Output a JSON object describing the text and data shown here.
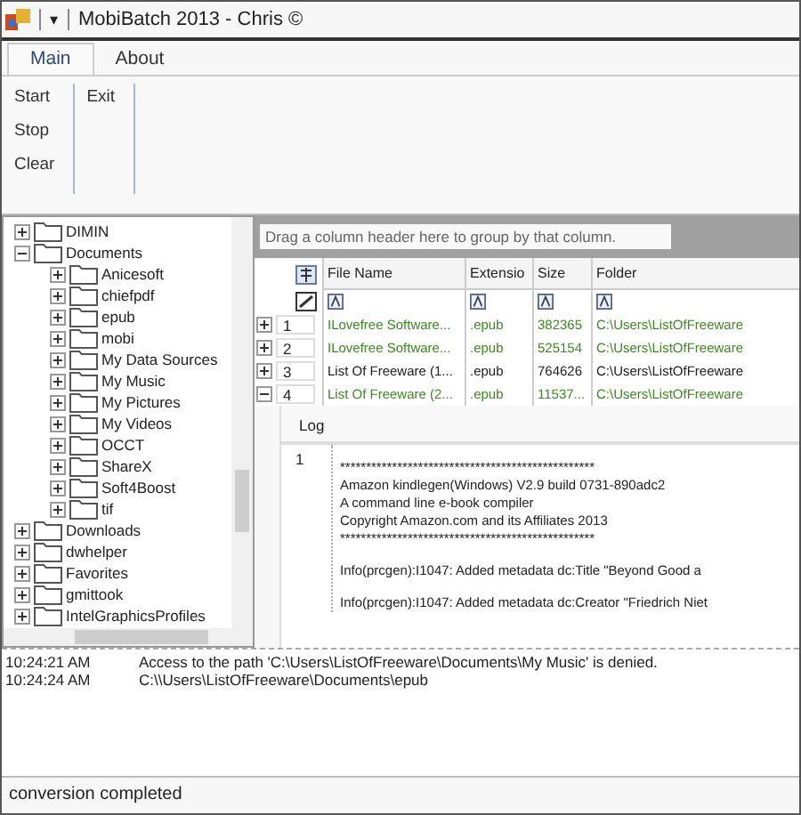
{
  "window": {
    "title": "MobiBatch 2013 - Chris ©",
    "quick_access": "▾"
  },
  "tabs": [
    {
      "label": "Main",
      "selected": true
    },
    {
      "label": "About",
      "selected": false
    }
  ],
  "ribbon": {
    "groups": [
      {
        "buttons": [
          "Start",
          "Stop",
          "Clear"
        ]
      },
      {
        "buttons": [
          "Exit"
        ]
      }
    ]
  },
  "tree": {
    "items": [
      {
        "label": "DIMIN",
        "expanded": false
      },
      {
        "label": "Documents",
        "expanded": true,
        "children": [
          {
            "label": "Anicesoft",
            "expanded": false
          },
          {
            "label": "chiefpdf",
            "expanded": false
          },
          {
            "label": "epub",
            "expanded": false
          },
          {
            "label": "mobi",
            "expanded": false
          },
          {
            "label": "My Data Sources",
            "expanded": false
          },
          {
            "label": "My Music",
            "expanded": false
          },
          {
            "label": "My Pictures",
            "expanded": false
          },
          {
            "label": "My Videos",
            "expanded": false
          },
          {
            "label": "OCCT",
            "expanded": false
          },
          {
            "label": "ShareX",
            "expanded": false
          },
          {
            "label": "Soft4Boost",
            "expanded": false
          },
          {
            "label": "tif",
            "expanded": false
          }
        ]
      },
      {
        "label": "Downloads",
        "expanded": false
      },
      {
        "label": "dwhelper",
        "expanded": false
      },
      {
        "label": "Favorites",
        "expanded": false
      },
      {
        "label": "gmittook",
        "expanded": false
      },
      {
        "label": "IntelGraphicsProfiles",
        "expanded": false
      }
    ]
  },
  "grid": {
    "group_hint": "Drag a column header here to group by that column.",
    "columns": [
      "File Name",
      "Extensio",
      "Size",
      "Folder"
    ],
    "rows": [
      {
        "number": "1",
        "expanded": false,
        "color": "#3a8a1e",
        "cells": [
          "ILovefree Software...",
          ".epub",
          "382365",
          "C:\\Users\\ListOfFreeware"
        ]
      },
      {
        "number": "2",
        "expanded": false,
        "color": "#3a8a1e",
        "cells": [
          "ILovefree Software...",
          ".epub",
          "525154",
          "C:\\Users\\ListOfFreeware"
        ]
      },
      {
        "number": "3",
        "expanded": false,
        "color": "#202020",
        "cells": [
          "List Of Freeware (1...",
          ".epub",
          "764626",
          "C:\\Users\\ListOfFreeware"
        ]
      },
      {
        "number": "4",
        "expanded": true,
        "color": "#3a8a1e",
        "cells": [
          "List Of Freeware (2...",
          ".epub",
          "11537...",
          "C:\\Users\\ListOfFreeware"
        ]
      }
    ]
  },
  "detail": {
    "header": "Log",
    "line_number": "1",
    "banner": [
      "*************************************************",
      "Amazon kindlegen(Windows) V2.9 build 0731-890adc2",
      "A command line e-book compiler",
      "Copyright Amazon.com and its Affiliates 2013",
      "*************************************************"
    ],
    "info": [
      "Info(prcgen):I1047: Added metadata dc:Title \"Beyond Good a",
      "Info(prcgen):I1047: Added metadata dc:Creator \"Friedrich Niet"
    ]
  },
  "messages": [
    {
      "time": "10:24:21 AM",
      "text": "Access to the path 'C:\\Users\\ListOfFreeware\\Documents\\My Music' is denied."
    },
    {
      "time": "10:24:24 AM",
      "text": "C:\\\\Users\\ListOfFreeware\\Documents\\epub"
    }
  ],
  "status_bar": "conversion completed"
}
